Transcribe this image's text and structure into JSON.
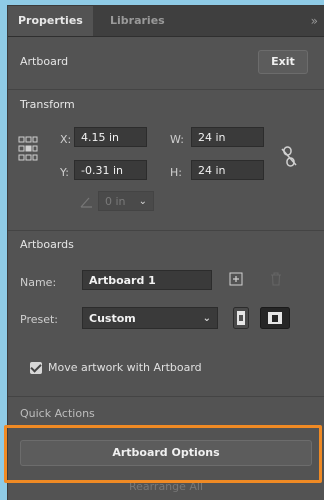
{
  "tabs": {
    "active": "Properties",
    "other": "Libraries",
    "collapse": "»"
  },
  "artboard": {
    "label": "Artboard",
    "exit": "Exit"
  },
  "transform": {
    "title": "Transform",
    "x_label": "X:",
    "x_value": "4.15 in",
    "y_label": "Y:",
    "y_value": "-0.31 in",
    "w_label": "W:",
    "w_value": "24 in",
    "h_label": "H:",
    "h_value": "24 in",
    "angle_value": "0 in"
  },
  "artboards": {
    "title": "Artboards",
    "name_label": "Name:",
    "name_value": "Artboard 1",
    "preset_label": "Preset:",
    "preset_value": "Custom",
    "move_label": "Move artwork with Artboard"
  },
  "quick_actions": {
    "title": "Quick Actions",
    "options_button": "Artboard Options",
    "rearrange_button": "Rearrange All"
  },
  "colors": {
    "highlight": "#f08a24",
    "background": "#8fcbe6",
    "panel": "#535353"
  },
  "icons": [
    "reference-point-icon",
    "constrain-proportions-icon",
    "angle-icon",
    "new-artboard-icon",
    "delete-artboard-icon",
    "portrait-icon",
    "landscape-icon",
    "chevron-down-icon"
  ]
}
